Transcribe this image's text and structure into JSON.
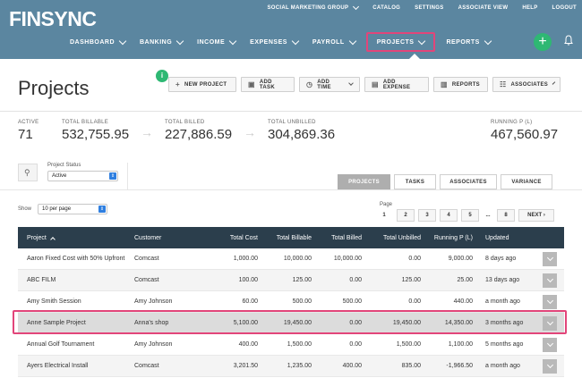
{
  "app": {
    "logo": "FINSYNC",
    "topnav": {
      "org": "SOCIAL MARKETING GROUP",
      "catalog": "CATALOG",
      "settings": "SETTINGS",
      "associate_view": "ASSOCIATE VIEW",
      "help": "HELP",
      "logout": "LOGOUT"
    },
    "mainnav": [
      {
        "label": "DASHBOARD"
      },
      {
        "label": "BANKING"
      },
      {
        "label": "INCOME"
      },
      {
        "label": "EXPENSES"
      },
      {
        "label": "PAYROLL"
      },
      {
        "label": "PROJECTS",
        "active": true
      },
      {
        "label": "REPORTS"
      }
    ],
    "plus_symbol": "+",
    "accent_color": "#e2457a",
    "header_color": "#5b86a0",
    "green_color": "#2eb873"
  },
  "page": {
    "title": "Projects",
    "badge": "i",
    "toolbar": {
      "new_project": "NEW PROJECT",
      "add_task": "ADD TASK",
      "add_time": "ADD TIME",
      "add_expense": "ADD EXPENSE",
      "reports": "REPORTS",
      "associates": "ASSOCIATES"
    },
    "stats": {
      "active_label": "ACTIVE",
      "active_value": "71",
      "billable_label": "TOTAL BILLABLE",
      "billable_value": "532,755.95",
      "billed_label": "TOTAL BILLED",
      "billed_value": "227,886.59",
      "unbilled_label": "TOTAL UNBILLED",
      "unbilled_value": "304,869.36",
      "running_label": "RUNNING P (L)",
      "running_value": "467,560.97"
    },
    "filter": {
      "status_label": "Project Status",
      "status_value": "Active",
      "show_label": "Show",
      "show_value": "10 per page",
      "page_label": "Page"
    },
    "tabs": {
      "projects": "PROJECTS",
      "tasks": "TASKS",
      "associates": "ASSOCIATES",
      "variance": "VARIANCE"
    },
    "pager": {
      "p1": "1",
      "p2": "2",
      "p3": "3",
      "p4": "4",
      "p5": "5",
      "dots": "...",
      "p8": "8",
      "next": "NEXT ›"
    }
  },
  "table": {
    "headers": {
      "project": "Project",
      "customer": "Customer",
      "total_cost": "Total Cost",
      "total_billable": "Total Billable",
      "total_billed": "Total Billed",
      "total_unbilled": "Total Unbilled",
      "running": "Running P (L)",
      "updated": "Updated"
    },
    "rows": [
      {
        "project": "Aaron Fixed Cost with 50% Upfront",
        "customer": "Comcast",
        "cost": "1,000.00",
        "billable": "10,000.00",
        "billed": "10,000.00",
        "unbilled": "0.00",
        "running": "9,000.00",
        "updated": "8 days ago"
      },
      {
        "project": "ABC FILM",
        "customer": "Comcast",
        "cost": "100.00",
        "billable": "125.00",
        "billed": "0.00",
        "unbilled": "125.00",
        "running": "25.00",
        "updated": "13 days ago"
      },
      {
        "project": "Amy Smith Session",
        "customer": "Amy Johnson",
        "cost": "60.00",
        "billable": "500.00",
        "billed": "500.00",
        "unbilled": "0.00",
        "running": "440.00",
        "updated": "a month ago"
      },
      {
        "project": "Anne Sample Project",
        "customer": "Anna's shop",
        "cost": "5,100.00",
        "billable": "19,450.00",
        "billed": "0.00",
        "unbilled": "19,450.00",
        "running": "14,350.00",
        "updated": "3 months ago"
      },
      {
        "project": "Annual Golf Tournament",
        "customer": "Amy Johnson",
        "cost": "400.00",
        "billable": "1,500.00",
        "billed": "0.00",
        "unbilled": "1,500.00",
        "running": "1,100.00",
        "updated": "5 months ago"
      },
      {
        "project": "Ayers Electrical Install",
        "customer": "Comcast",
        "cost": "3,201.50",
        "billable": "1,235.00",
        "billed": "400.00",
        "unbilled": "835.00",
        "running": "-1,966.50",
        "updated": "a month ago"
      }
    ]
  }
}
